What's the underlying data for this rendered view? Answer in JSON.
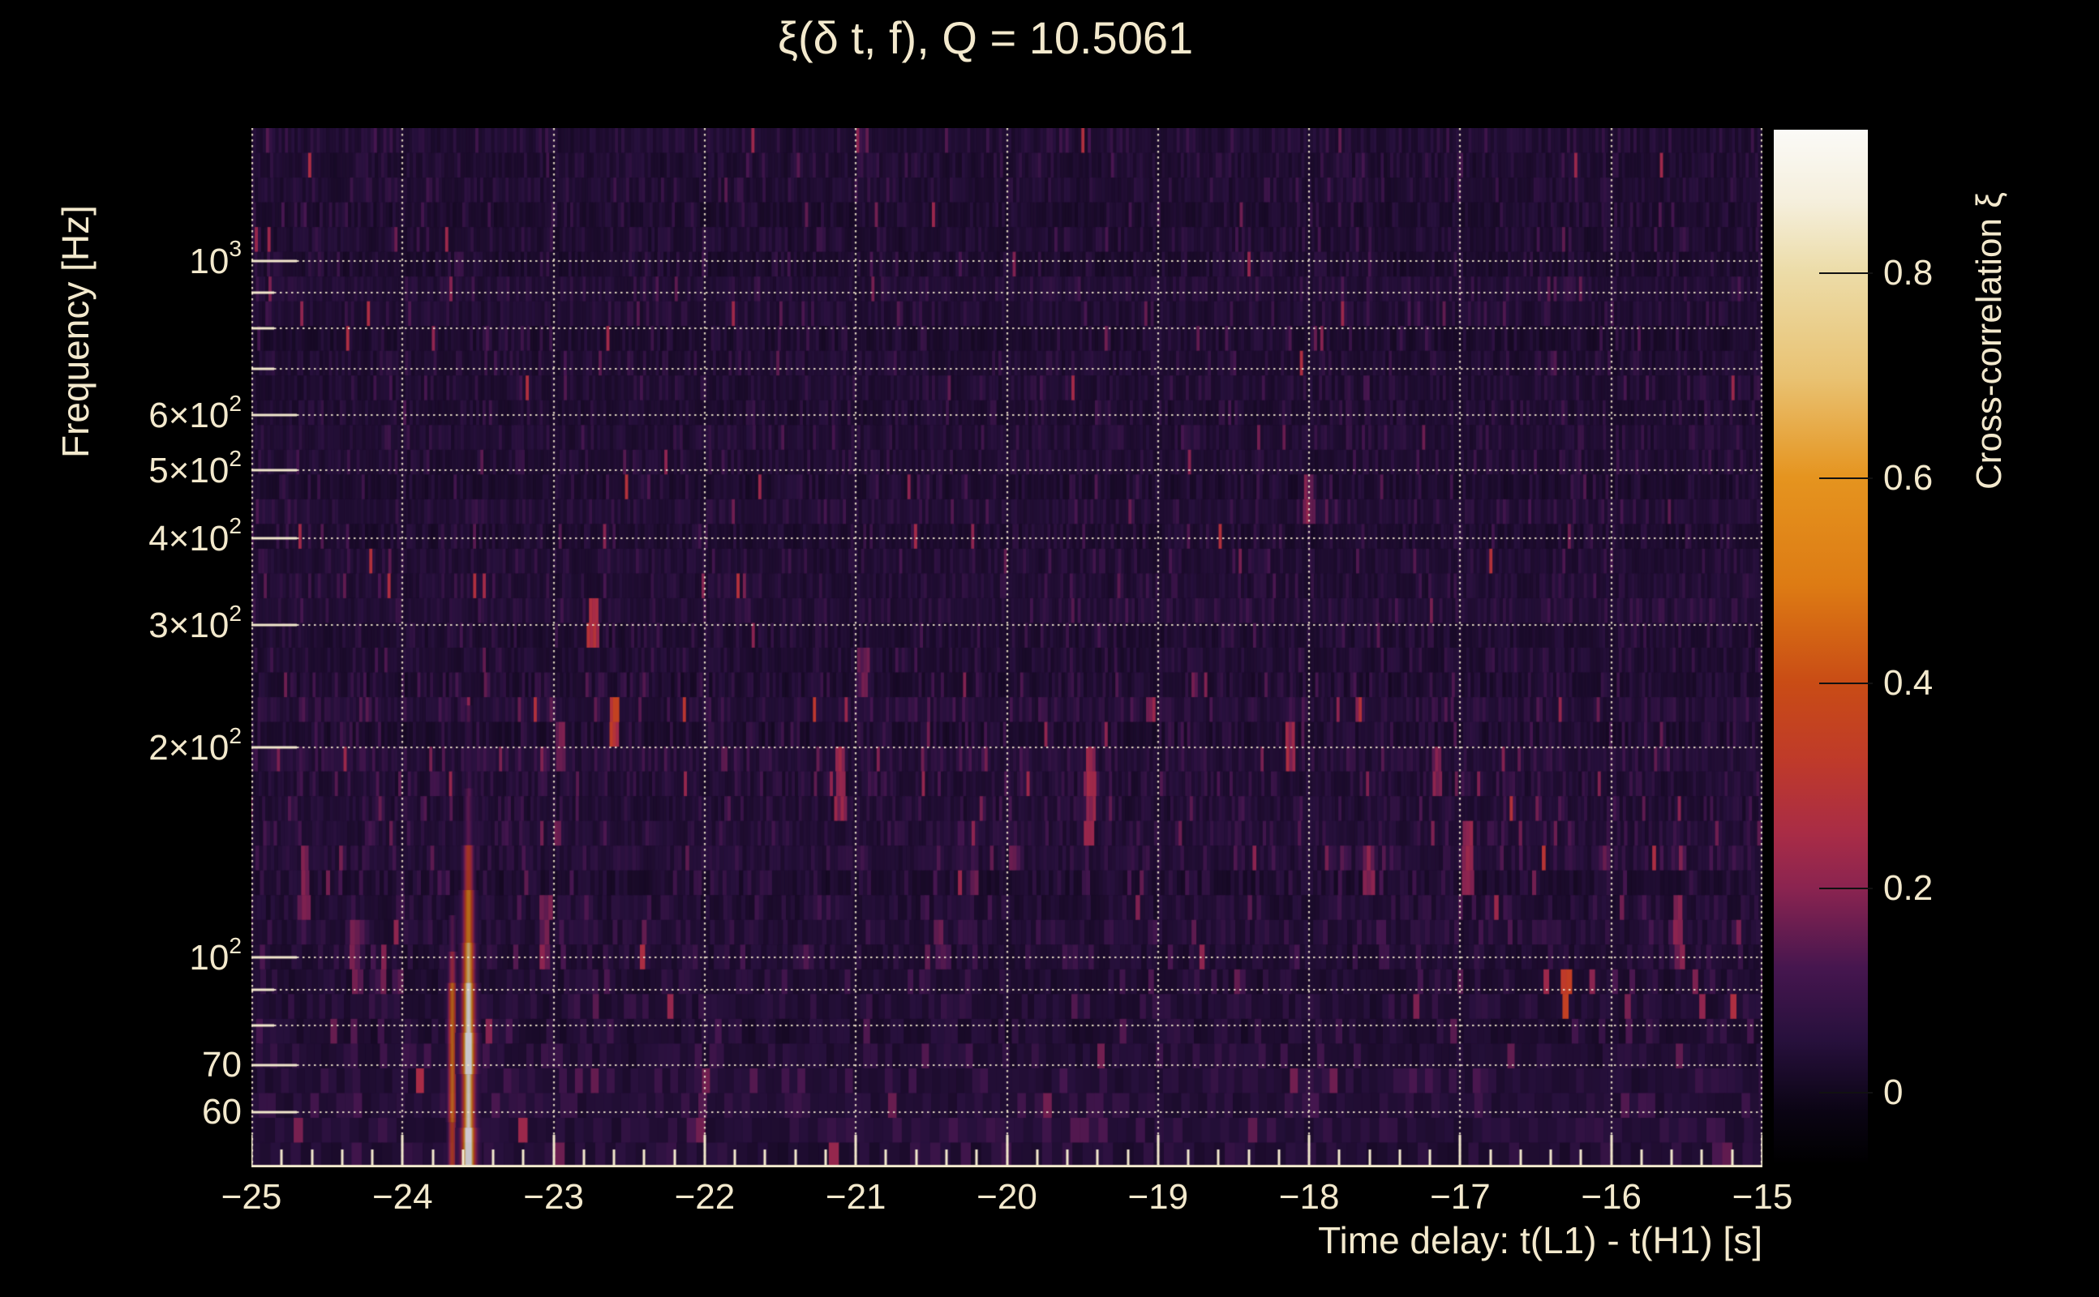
{
  "page": {
    "background": "#000000",
    "text_color": "#f3e9cd"
  },
  "chart_data": {
    "type": "heatmap",
    "title": "ξ(δ t, f), Q = 10.5061",
    "q_value": 10.5061,
    "xlabel": "Time delay: t(L1) - t(H1) [s]",
    "ylabel": "Frequency [Hz]",
    "zlabel": "Cross-correlation ξ",
    "x_range": [
      -25,
      -15
    ],
    "x_ticks": [
      {
        "v": -25,
        "label": "−25"
      },
      {
        "v": -24,
        "label": "−24"
      },
      {
        "v": -23,
        "label": "−23"
      },
      {
        "v": -22,
        "label": "−22"
      },
      {
        "v": -21,
        "label": "−21"
      },
      {
        "v": -20,
        "label": "−20"
      },
      {
        "v": -19,
        "label": "−19"
      },
      {
        "v": -18,
        "label": "−18"
      },
      {
        "v": -17,
        "label": "−17"
      },
      {
        "v": -16,
        "label": "−16"
      },
      {
        "v": -15,
        "label": "−15"
      }
    ],
    "x_minor_tick_step": 0.2,
    "y_scale": "log",
    "y_range_hz": [
      50,
      1550
    ],
    "y_ticks": [
      {
        "f": 1000,
        "base": "10",
        "sup": "3"
      },
      {
        "f": 600,
        "base": "6×10",
        "sup": "2"
      },
      {
        "f": 500,
        "base": "5×10",
        "sup": "2"
      },
      {
        "f": 400,
        "base": "4×10",
        "sup": "2"
      },
      {
        "f": 300,
        "base": "3×10",
        "sup": "2"
      },
      {
        "f": 200,
        "base": "2×10",
        "sup": "2"
      },
      {
        "f": 100,
        "base": "10",
        "sup": "2"
      },
      {
        "f": 70,
        "base": "70",
        "sup": ""
      },
      {
        "f": 60,
        "base": "60",
        "sup": ""
      }
    ],
    "y_minor_ticks": [
      900,
      800,
      700,
      90,
      80
    ],
    "y_gridlines": [
      1000,
      900,
      800,
      700,
      600,
      500,
      400,
      300,
      200,
      100,
      90,
      80,
      70,
      60
    ],
    "grid_color": "#f3e9cd",
    "colorbar": {
      "value_min": -0.07,
      "value_max": 0.94,
      "ticks": [
        {
          "v": 0.8,
          "label": "0.8"
        },
        {
          "v": 0.6,
          "label": "0.6"
        },
        {
          "v": 0.4,
          "label": "0.4"
        },
        {
          "v": 0.2,
          "label": "0.2"
        },
        {
          "v": 0.0,
          "label": "0"
        }
      ],
      "stops": [
        [
          0.0,
          "#000000"
        ],
        [
          0.05,
          "#0a0413"
        ],
        [
          0.12,
          "#27103c"
        ],
        [
          0.19,
          "#46164f"
        ],
        [
          0.268,
          "#8b2450"
        ],
        [
          0.32,
          "#a92c46"
        ],
        [
          0.39,
          "#bf3a2a"
        ],
        [
          0.466,
          "#c94c15"
        ],
        [
          0.56,
          "#dd7b14"
        ],
        [
          0.664,
          "#e5941f"
        ],
        [
          0.76,
          "#e9c272"
        ],
        [
          0.863,
          "#ecdca8"
        ],
        [
          0.93,
          "#f5efdc"
        ],
        [
          1.0,
          "#fbfaf7"
        ]
      ]
    },
    "noise": {
      "seed": 42,
      "base": 0.016,
      "row_bias": 0.02,
      "tail": 0.021,
      "spike_prob": 0.006
    },
    "features": {
      "main_streak": {
        "t": -23.565,
        "sigma_t": 0.02,
        "halo_sigma_t": 0.05,
        "halo_amp": 0.3,
        "profile": [
          [
            50,
            57,
            0.95
          ],
          [
            57,
            68,
            0.68
          ],
          [
            68,
            78,
            0.93
          ],
          [
            78,
            92,
            0.72
          ],
          [
            92,
            105,
            0.55
          ],
          [
            105,
            125,
            0.42
          ],
          [
            125,
            145,
            0.28
          ],
          [
            145,
            175,
            0.12
          ],
          [
            175,
            230,
            0.07
          ]
        ]
      },
      "secondary_streak": {
        "t": -23.672,
        "sigma_t": 0.016,
        "halo_sigma_t": 0.04,
        "halo_amp": 0.25,
        "profile": [
          [
            50,
            58,
            0.3
          ],
          [
            58,
            92,
            0.4
          ],
          [
            92,
            102,
            0.22
          ],
          [
            102,
            115,
            0.12
          ]
        ]
      },
      "hotspots": [
        {
          "t": -24.65,
          "f_lo": 110,
          "f_hi": 140,
          "v": 0.17
        },
        {
          "t": -24.3,
          "f_lo": 90,
          "f_hi": 110,
          "v": 0.15
        },
        {
          "t": -23.05,
          "f_lo": 95,
          "f_hi": 120,
          "v": 0.17
        },
        {
          "t": -22.95,
          "f_lo": 180,
          "f_hi": 210,
          "v": 0.16
        },
        {
          "t": -22.74,
          "f_lo": 270,
          "f_hi": 340,
          "v": 0.26
        },
        {
          "t": -22.6,
          "f_lo": 195,
          "f_hi": 245,
          "v": 0.3
        },
        {
          "t": -22.0,
          "f_lo": 55,
          "f_hi": 70,
          "v": 0.16
        },
        {
          "t": -21.1,
          "f_lo": 160,
          "f_hi": 195,
          "v": 0.2
        },
        {
          "t": -20.95,
          "f_lo": 240,
          "f_hi": 280,
          "v": 0.15
        },
        {
          "t": -20.45,
          "f_lo": 95,
          "f_hi": 115,
          "v": 0.14
        },
        {
          "t": -19.95,
          "f_lo": 130,
          "f_hi": 150,
          "v": 0.15
        },
        {
          "t": -19.45,
          "f_lo": 150,
          "f_hi": 205,
          "v": 0.22
        },
        {
          "t": -19.05,
          "f_lo": 225,
          "f_hi": 245,
          "v": 0.2
        },
        {
          "t": -18.12,
          "f_lo": 185,
          "f_hi": 215,
          "v": 0.22
        },
        {
          "t": -18.0,
          "f_lo": 420,
          "f_hi": 480,
          "v": 0.18
        },
        {
          "t": -17.6,
          "f_lo": 120,
          "f_hi": 145,
          "v": 0.18
        },
        {
          "t": -17.15,
          "f_lo": 170,
          "f_hi": 200,
          "v": 0.17
        },
        {
          "t": -16.95,
          "f_lo": 120,
          "f_hi": 155,
          "v": 0.22
        },
        {
          "t": -16.31,
          "f_lo": 80,
          "f_hi": 100,
          "v": 0.3
        },
        {
          "t": -15.55,
          "f_lo": 95,
          "f_hi": 118,
          "v": 0.18
        }
      ]
    }
  }
}
